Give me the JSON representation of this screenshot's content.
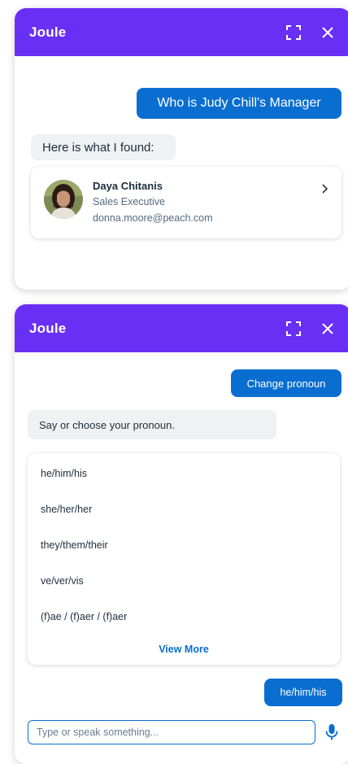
{
  "colors": {
    "header_bg": "#6a2ff5",
    "user_bubble": "#0a6ed1",
    "bot_bubble": "#eff1f2",
    "link": "#0a6ed1"
  },
  "panel1": {
    "title": "Joule",
    "header_icons": [
      "expand-icon",
      "close-icon"
    ],
    "user_message": "Who is Judy Chill's Manager",
    "bot_message": "Here is what I found:",
    "card": {
      "name": "Daya Chitanis",
      "role": "Sales Executive",
      "email": "donna.moore@peach.com",
      "icon": "chevron-right-icon"
    }
  },
  "panel2": {
    "title": "Joule",
    "header_icons": [
      "expand-icon",
      "close-icon"
    ],
    "user_message": "Change pronoun",
    "bot_message": "Say or choose your pronoun.",
    "options": [
      "he/him/his",
      "she/her/her",
      "they/them/their",
      "ve/ver/vis",
      "(f)ae / (f)aer / (f)aer"
    ],
    "view_more": "View More",
    "user_reply": "he/him/his",
    "input_placeholder": "Type or speak something...",
    "input_icon": "microphone-icon"
  }
}
